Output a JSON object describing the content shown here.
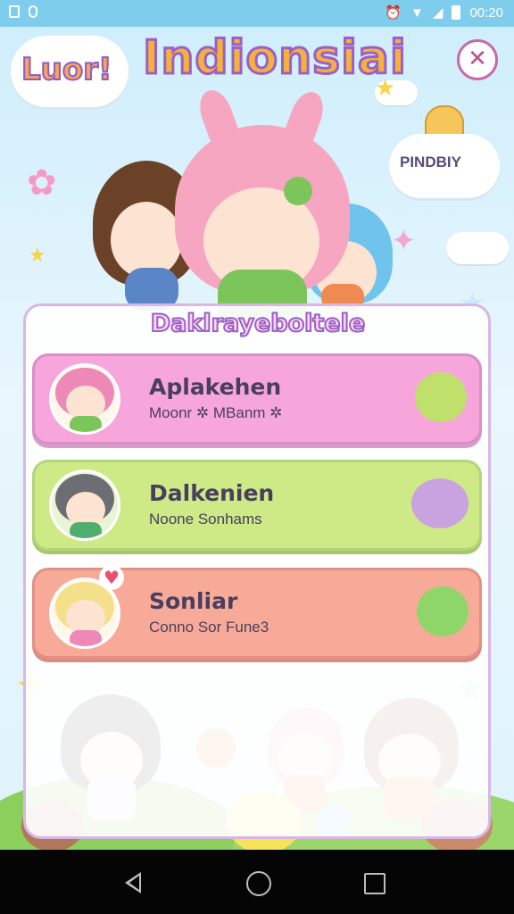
{
  "status_bar": {
    "time": "00:20"
  },
  "header": {
    "logo_text": "Luor!",
    "title": "Indionsiai",
    "close_glyph": "✕",
    "badge_text": "PINDBIY"
  },
  "panel": {
    "title": "Daklrayeboltele",
    "cards": [
      {
        "name": "Aplakehen",
        "subtitle": "Moonr ✲ MBanm ✲"
      },
      {
        "name": "Dalkenien",
        "subtitle": "Noone Sonhams"
      },
      {
        "name": "Sonliar",
        "subtitle": "Conno Sor Fune3"
      }
    ]
  },
  "nav": {
    "back": "back-icon",
    "home": "home-icon",
    "recent": "recent-apps-icon"
  },
  "colors": {
    "accent": "#9b5fc9",
    "card_pink": "#f7a6dc",
    "card_green": "#cdea87",
    "card_coral": "#f8aa98"
  }
}
